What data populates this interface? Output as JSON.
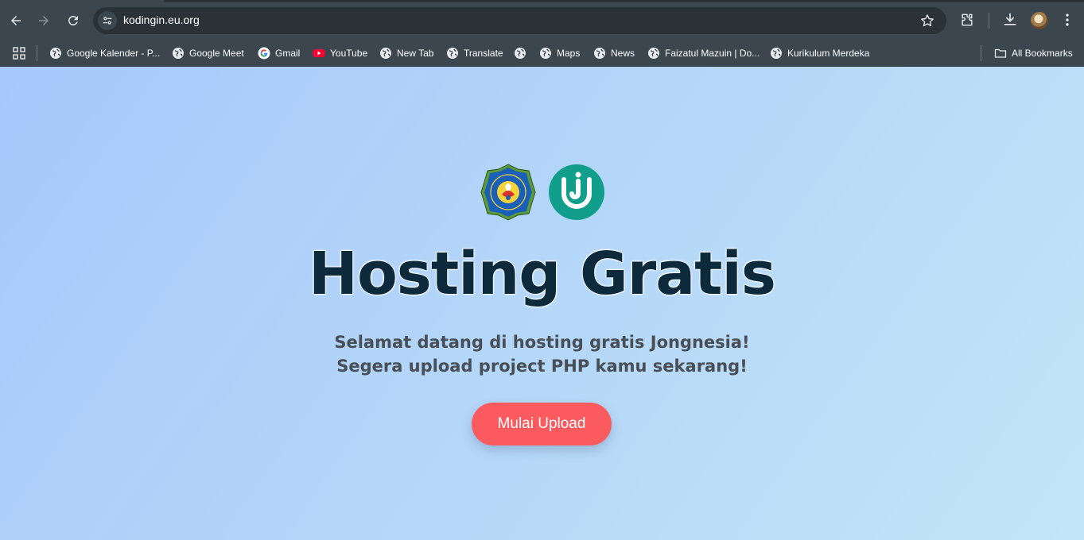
{
  "browser": {
    "url": "kodingin.eu.org",
    "colors": {
      "chrome_bg": "#3b464f",
      "omnibox_bg": "#2a3238",
      "icon": "#e8eaed"
    }
  },
  "bookmarks": {
    "items": [
      {
        "label": "Google Kalender - P...",
        "icon": "globe-icon"
      },
      {
        "label": "Google Meet",
        "icon": "globe-icon"
      },
      {
        "label": "Gmail",
        "icon": "google-icon"
      },
      {
        "label": "YouTube",
        "icon": "youtube-icon"
      },
      {
        "label": "New Tab",
        "icon": "globe-icon"
      },
      {
        "label": "Translate",
        "icon": "globe-icon"
      },
      {
        "label": "",
        "icon": "globe-icon"
      },
      {
        "label": "Maps",
        "icon": "globe-icon"
      },
      {
        "label": "News",
        "icon": "globe-icon"
      },
      {
        "label": "Faizatul Mazuin | Do...",
        "icon": "globe-icon"
      },
      {
        "label": "Kurikulum Merdeka",
        "icon": "globe-icon"
      }
    ],
    "all_bookmarks": "All Bookmarks"
  },
  "hero": {
    "title": "Hosting Gratis",
    "subtitle_line1": "Selamat datang di hosting gratis Jongnesia!",
    "subtitle_line2": "Segera upload project PHP kamu sekarang!",
    "cta_label": "Mulai Upload",
    "colors": {
      "title": "#0d2a3d",
      "subtitle": "#474e56",
      "cta_bg": "#fb5b5e",
      "logo_j": "#119e8b"
    }
  },
  "logos": [
    {
      "icon": "university-seal-icon",
      "text": "UNIVERSITAS PGRI RONGGOLAWE TUBAN"
    },
    {
      "icon": "jongnesia-j-logo-icon"
    }
  ]
}
